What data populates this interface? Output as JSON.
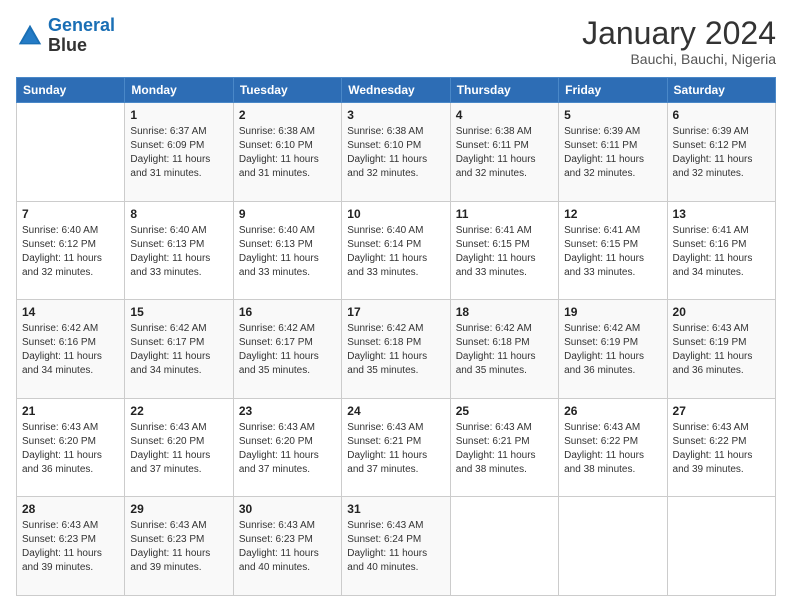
{
  "header": {
    "logo_line1": "General",
    "logo_line2": "Blue",
    "main_title": "January 2024",
    "sub_title": "Bauchi, Bauchi, Nigeria"
  },
  "days_of_week": [
    "Sunday",
    "Monday",
    "Tuesday",
    "Wednesday",
    "Thursday",
    "Friday",
    "Saturday"
  ],
  "weeks": [
    [
      {
        "day": "",
        "sunrise": "",
        "sunset": "",
        "daylight": ""
      },
      {
        "day": "1",
        "sunrise": "Sunrise: 6:37 AM",
        "sunset": "Sunset: 6:09 PM",
        "daylight": "Daylight: 11 hours and 31 minutes."
      },
      {
        "day": "2",
        "sunrise": "Sunrise: 6:38 AM",
        "sunset": "Sunset: 6:10 PM",
        "daylight": "Daylight: 11 hours and 31 minutes."
      },
      {
        "day": "3",
        "sunrise": "Sunrise: 6:38 AM",
        "sunset": "Sunset: 6:10 PM",
        "daylight": "Daylight: 11 hours and 32 minutes."
      },
      {
        "day": "4",
        "sunrise": "Sunrise: 6:38 AM",
        "sunset": "Sunset: 6:11 PM",
        "daylight": "Daylight: 11 hours and 32 minutes."
      },
      {
        "day": "5",
        "sunrise": "Sunrise: 6:39 AM",
        "sunset": "Sunset: 6:11 PM",
        "daylight": "Daylight: 11 hours and 32 minutes."
      },
      {
        "day": "6",
        "sunrise": "Sunrise: 6:39 AM",
        "sunset": "Sunset: 6:12 PM",
        "daylight": "Daylight: 11 hours and 32 minutes."
      }
    ],
    [
      {
        "day": "7",
        "sunrise": "Sunrise: 6:40 AM",
        "sunset": "Sunset: 6:12 PM",
        "daylight": "Daylight: 11 hours and 32 minutes."
      },
      {
        "day": "8",
        "sunrise": "Sunrise: 6:40 AM",
        "sunset": "Sunset: 6:13 PM",
        "daylight": "Daylight: 11 hours and 33 minutes."
      },
      {
        "day": "9",
        "sunrise": "Sunrise: 6:40 AM",
        "sunset": "Sunset: 6:13 PM",
        "daylight": "Daylight: 11 hours and 33 minutes."
      },
      {
        "day": "10",
        "sunrise": "Sunrise: 6:40 AM",
        "sunset": "Sunset: 6:14 PM",
        "daylight": "Daylight: 11 hours and 33 minutes."
      },
      {
        "day": "11",
        "sunrise": "Sunrise: 6:41 AM",
        "sunset": "Sunset: 6:15 PM",
        "daylight": "Daylight: 11 hours and 33 minutes."
      },
      {
        "day": "12",
        "sunrise": "Sunrise: 6:41 AM",
        "sunset": "Sunset: 6:15 PM",
        "daylight": "Daylight: 11 hours and 33 minutes."
      },
      {
        "day": "13",
        "sunrise": "Sunrise: 6:41 AM",
        "sunset": "Sunset: 6:16 PM",
        "daylight": "Daylight: 11 hours and 34 minutes."
      }
    ],
    [
      {
        "day": "14",
        "sunrise": "Sunrise: 6:42 AM",
        "sunset": "Sunset: 6:16 PM",
        "daylight": "Daylight: 11 hours and 34 minutes."
      },
      {
        "day": "15",
        "sunrise": "Sunrise: 6:42 AM",
        "sunset": "Sunset: 6:17 PM",
        "daylight": "Daylight: 11 hours and 34 minutes."
      },
      {
        "day": "16",
        "sunrise": "Sunrise: 6:42 AM",
        "sunset": "Sunset: 6:17 PM",
        "daylight": "Daylight: 11 hours and 35 minutes."
      },
      {
        "day": "17",
        "sunrise": "Sunrise: 6:42 AM",
        "sunset": "Sunset: 6:18 PM",
        "daylight": "Daylight: 11 hours and 35 minutes."
      },
      {
        "day": "18",
        "sunrise": "Sunrise: 6:42 AM",
        "sunset": "Sunset: 6:18 PM",
        "daylight": "Daylight: 11 hours and 35 minutes."
      },
      {
        "day": "19",
        "sunrise": "Sunrise: 6:42 AM",
        "sunset": "Sunset: 6:19 PM",
        "daylight": "Daylight: 11 hours and 36 minutes."
      },
      {
        "day": "20",
        "sunrise": "Sunrise: 6:43 AM",
        "sunset": "Sunset: 6:19 PM",
        "daylight": "Daylight: 11 hours and 36 minutes."
      }
    ],
    [
      {
        "day": "21",
        "sunrise": "Sunrise: 6:43 AM",
        "sunset": "Sunset: 6:20 PM",
        "daylight": "Daylight: 11 hours and 36 minutes."
      },
      {
        "day": "22",
        "sunrise": "Sunrise: 6:43 AM",
        "sunset": "Sunset: 6:20 PM",
        "daylight": "Daylight: 11 hours and 37 minutes."
      },
      {
        "day": "23",
        "sunrise": "Sunrise: 6:43 AM",
        "sunset": "Sunset: 6:20 PM",
        "daylight": "Daylight: 11 hours and 37 minutes."
      },
      {
        "day": "24",
        "sunrise": "Sunrise: 6:43 AM",
        "sunset": "Sunset: 6:21 PM",
        "daylight": "Daylight: 11 hours and 37 minutes."
      },
      {
        "day": "25",
        "sunrise": "Sunrise: 6:43 AM",
        "sunset": "Sunset: 6:21 PM",
        "daylight": "Daylight: 11 hours and 38 minutes."
      },
      {
        "day": "26",
        "sunrise": "Sunrise: 6:43 AM",
        "sunset": "Sunset: 6:22 PM",
        "daylight": "Daylight: 11 hours and 38 minutes."
      },
      {
        "day": "27",
        "sunrise": "Sunrise: 6:43 AM",
        "sunset": "Sunset: 6:22 PM",
        "daylight": "Daylight: 11 hours and 39 minutes."
      }
    ],
    [
      {
        "day": "28",
        "sunrise": "Sunrise: 6:43 AM",
        "sunset": "Sunset: 6:23 PM",
        "daylight": "Daylight: 11 hours and 39 minutes."
      },
      {
        "day": "29",
        "sunrise": "Sunrise: 6:43 AM",
        "sunset": "Sunset: 6:23 PM",
        "daylight": "Daylight: 11 hours and 39 minutes."
      },
      {
        "day": "30",
        "sunrise": "Sunrise: 6:43 AM",
        "sunset": "Sunset: 6:23 PM",
        "daylight": "Daylight: 11 hours and 40 minutes."
      },
      {
        "day": "31",
        "sunrise": "Sunrise: 6:43 AM",
        "sunset": "Sunset: 6:24 PM",
        "daylight": "Daylight: 11 hours and 40 minutes."
      },
      {
        "day": "",
        "sunrise": "",
        "sunset": "",
        "daylight": ""
      },
      {
        "day": "",
        "sunrise": "",
        "sunset": "",
        "daylight": ""
      },
      {
        "day": "",
        "sunrise": "",
        "sunset": "",
        "daylight": ""
      }
    ]
  ]
}
